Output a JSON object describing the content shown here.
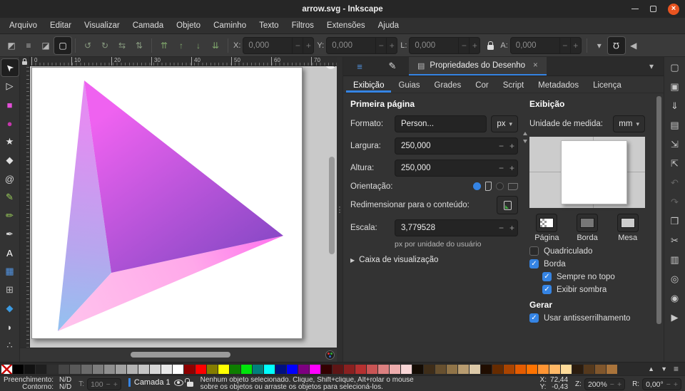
{
  "window": {
    "title": "arrow.svg - Inkscape"
  },
  "icons": {
    "minus": "−",
    "plus": "+",
    "dropdown": "▾",
    "close": "×",
    "check": "✓",
    "expander": "▶",
    "grip": "⋮",
    "up_small": "▲",
    "down_small": "▼",
    "left_small": "◀",
    "magnet": "Ω",
    "hamburger": "≡",
    "more": "▶",
    "tab_icon": "▤",
    "selector": "➤"
  },
  "menubar": [
    "Arquivo",
    "Editar",
    "Visualizar",
    "Camada",
    "Objeto",
    "Caminho",
    "Texto",
    "Filtros",
    "Extensões",
    "Ajuda"
  ],
  "toolbar": {
    "select_options": [
      {
        "name": "select-object",
        "glyph": "◩"
      },
      {
        "name": "select-in-layers",
        "glyph": "≡"
      },
      {
        "name": "select-touched",
        "glyph": "◪"
      },
      {
        "name": "toggle-selection-box",
        "glyph": "▢",
        "active": true
      }
    ],
    "transforms": [
      {
        "name": "rotate-ccw",
        "glyph": "↺"
      },
      {
        "name": "rotate-cw",
        "glyph": "↻"
      },
      {
        "name": "flip-horizontal",
        "glyph": "⇆"
      },
      {
        "name": "flip-vertical",
        "glyph": "⇅"
      }
    ],
    "arrange": [
      {
        "name": "raise-to-top",
        "glyph": "⇈"
      },
      {
        "name": "raise",
        "glyph": "↑"
      },
      {
        "name": "lower",
        "glyph": "↓"
      },
      {
        "name": "lower-to-bottom",
        "glyph": "⇊"
      }
    ],
    "fields": [
      {
        "label": "X:",
        "value": "0,000"
      },
      {
        "label": "Y:",
        "value": "0,000"
      },
      {
        "label": "L:",
        "value": "0,000"
      },
      {
        "label": "A:",
        "value": "0,000"
      }
    ]
  },
  "tools": [
    {
      "name": "selector",
      "glyph": "➤",
      "color": "#f0f0f0",
      "active": true,
      "rot": true
    },
    {
      "name": "node-editor",
      "glyph": "▷",
      "color": "#e8e8e8"
    },
    {
      "name": "rectangle",
      "glyph": "■",
      "color": "#e34fd8"
    },
    {
      "name": "ellipse",
      "glyph": "●",
      "color": "#c437ab"
    },
    {
      "name": "star",
      "glyph": "★",
      "color": "#e0e0e0"
    },
    {
      "name": "box-3d",
      "glyph": "◆",
      "color": "#e0e0e0"
    },
    {
      "name": "spiral",
      "glyph": "@",
      "color": "#d8d8d8"
    },
    {
      "name": "pencil",
      "glyph": "✎",
      "color": "#9acd5a"
    },
    {
      "name": "pen",
      "glyph": "✏",
      "color": "#9acd5a"
    },
    {
      "name": "calligraphy",
      "glyph": "✒",
      "color": "#d8d8d8"
    },
    {
      "name": "text",
      "glyph": "A",
      "color": "#ffffff"
    },
    {
      "name": "gradient",
      "glyph": "▦",
      "color": "#5294e2"
    },
    {
      "name": "mesh",
      "glyph": "⊞",
      "color": "#b8b8b8"
    },
    {
      "name": "dropper",
      "glyph": "◆",
      "color": "#3b9ae1"
    },
    {
      "name": "paint-bucket",
      "glyph": "◗",
      "color": "#d8d8d8"
    },
    {
      "name": "spray",
      "glyph": "∴",
      "color": "#c8c8c8"
    }
  ],
  "canvas": {
    "ruler_numbers": [
      "0",
      "10",
      "20",
      "30",
      "40",
      "50",
      "60",
      "70"
    ]
  },
  "panel": {
    "dock_icons": [
      {
        "name": "objects-dock",
        "glyph": "≡",
        "color": "#5294e2"
      },
      {
        "name": "fill-stroke-dock",
        "glyph": "✎",
        "color": "#dddddd"
      }
    ],
    "dock_tab": {
      "label": "Propriedades do Desenho"
    },
    "subtabs": [
      {
        "label": "Exibição",
        "active": true
      },
      {
        "label": "Guias"
      },
      {
        "label": "Grades"
      },
      {
        "label": "Cor"
      },
      {
        "label": "Script"
      },
      {
        "label": "Metadados"
      },
      {
        "label": "Licença"
      }
    ],
    "left": {
      "section_title": "Primeira página",
      "formato_label": "Formato:",
      "formato_value": "Person...",
      "formato_unit": "px",
      "largura_label": "Largura:",
      "largura_value": "250,000",
      "altura_label": "Altura:",
      "altura_value": "250,000",
      "orientacao_label": "Orientação:",
      "resize_label": "Redimensionar para o conteúdo:",
      "escala_label": "Escala:",
      "escala_value": "3,779528",
      "escala_note": "px por unidade do usuário",
      "viewbox_label": "Caixa de visualização"
    },
    "right": {
      "section_title": "Exibição",
      "unit_label": "Unidade de medida:",
      "unit_value": "mm",
      "buttons": [
        {
          "label": "Página",
          "checker": true,
          "color": "#ffffff"
        },
        {
          "label": "Borda",
          "color": "#777777"
        },
        {
          "label": "Mesa",
          "color": "#cccccc"
        }
      ],
      "checkboxes": [
        {
          "label": "Quadriculado",
          "checked": false
        },
        {
          "label": "Borda",
          "checked": true
        },
        {
          "label": "Sempre no topo",
          "checked": true,
          "indent": true
        },
        {
          "label": "Exibir sombra",
          "checked": true,
          "indent": true
        }
      ],
      "gerar_title": "Gerar",
      "gerar_checkbox": {
        "label": "Usar antisserrilhamento",
        "checked": true
      }
    }
  },
  "commands": [
    {
      "name": "new-document",
      "glyph": "▢"
    },
    {
      "name": "open-document",
      "glyph": "▣"
    },
    {
      "name": "save-document",
      "glyph": "⇓"
    },
    {
      "name": "print",
      "glyph": "▤"
    },
    {
      "name": "import",
      "glyph": "⇲"
    },
    {
      "name": "export",
      "glyph": "⇱"
    },
    {
      "name": "undo",
      "glyph": "↶",
      "dim": true
    },
    {
      "name": "redo",
      "glyph": "↷",
      "dim": true
    },
    {
      "name": "duplicate",
      "glyph": "❒"
    },
    {
      "name": "cut",
      "glyph": "✂"
    },
    {
      "name": "paste",
      "glyph": "▥"
    },
    {
      "name": "zoom-selection",
      "glyph": "◎"
    },
    {
      "name": "zoom-drawing",
      "glyph": "◉"
    },
    {
      "name": "more",
      "glyph": "▶"
    }
  ],
  "palette": {
    "colors": [
      "#000000",
      "#121212",
      "#1f1f1f",
      "#303030",
      "#454545",
      "#595959",
      "#6b6b6b",
      "#7d7d7d",
      "#8f8f8f",
      "#a1a1a1",
      "#b3b3b3",
      "#c5c5c5",
      "#d7d7d7",
      "#e9e9e9",
      "#ffffff",
      "#8f0000",
      "#ff0000",
      "#847c00",
      "#ffff00",
      "#0e7d00",
      "#00e50b",
      "#00807d",
      "#00ffff",
      "#001080",
      "#0000ff",
      "#7d0080",
      "#ff00ff",
      "#330000",
      "#5e1515",
      "#8a2020",
      "#b63030",
      "#c95454",
      "#dc8080",
      "#edacac",
      "#f9d6d6",
      "#140c04",
      "#3e2d19",
      "#67502f",
      "#907448",
      "#b89c70",
      "#dcc9a8",
      "#200d00",
      "#662b00",
      "#aa4400",
      "#e55c00",
      "#ff7300",
      "#ff9433",
      "#ffb866",
      "#ffdb99",
      "#2b1c0e",
      "#55391d",
      "#80562c",
      "#aa743b"
    ]
  },
  "statusbar": {
    "fill_label": "Preenchimento:",
    "fill_value": "N/D",
    "stroke_label": "Contorno:",
    "stroke_value": "N/D",
    "opacity_label": "T:",
    "opacity_value": "100",
    "layer_name": "Camada 1",
    "message_line1": "Nenhum objeto selecionado. Clique, Shift+clique, Alt+rolar o mouse",
    "message_line2": "sobre os objetos ou arraste os objetos para selecioná-los.",
    "x_label": "X:",
    "x_value": "72,44",
    "y_label": "Y:",
    "y_value": "-0,43",
    "z_label": "Z:",
    "z_value": "200%",
    "r_label": "R:",
    "r_value": "0,00°"
  },
  "shape": {
    "magenta_top": "#ef62f0",
    "purple_bottom": "#7a45c0",
    "lavender": "#e38df2",
    "light_blue": "#8ac8f0",
    "pink_light": "#ffc2ec",
    "pink_vivid": "#ff70ee"
  }
}
